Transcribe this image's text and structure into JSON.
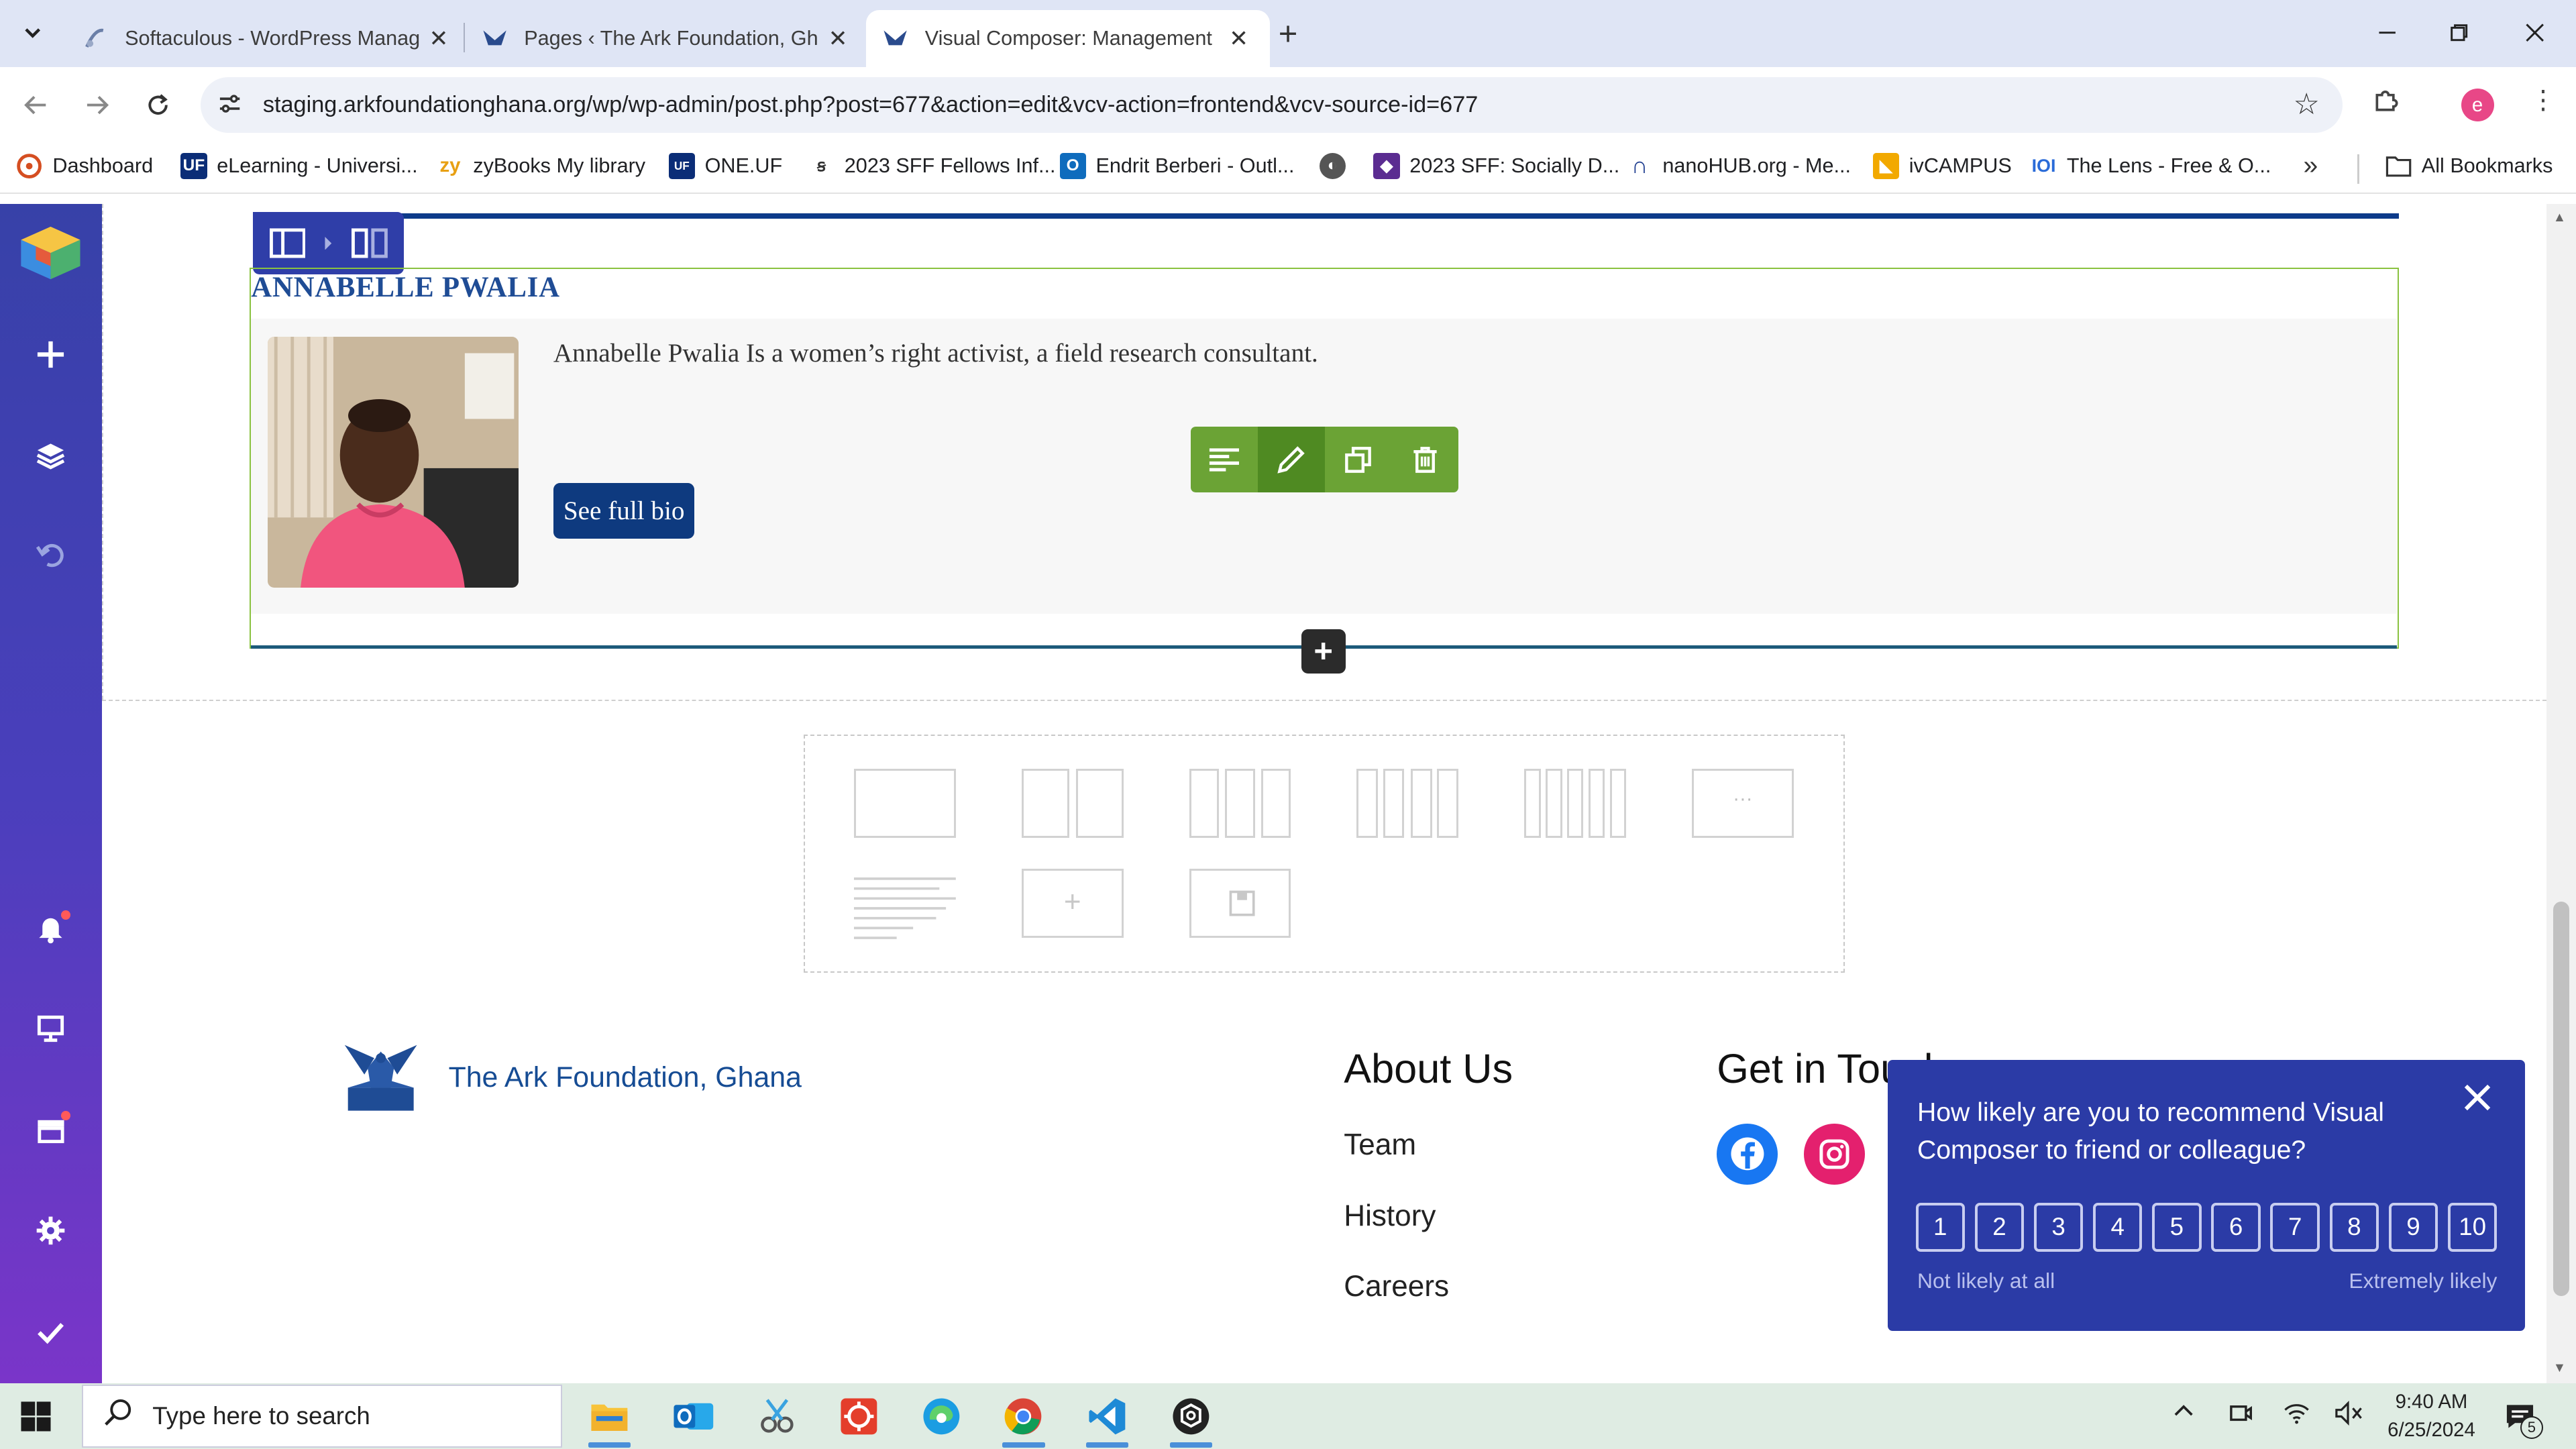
{
  "browser": {
    "tabs": [
      {
        "title": "Softaculous - WordPress Manag",
        "icon": "softaculous-icon",
        "active": false
      },
      {
        "title": "Pages ‹ The Ark Foundation, Gh",
        "icon": "ark-eagle-icon",
        "active": false
      },
      {
        "title": "Visual Composer: Management",
        "icon": "ark-eagle-icon",
        "active": true
      }
    ],
    "url": "staging.arkfoundationghana.org/wp/wp-admin/post.php?post=677&action=edit&vcv-action=frontend&vcv-source-id=677",
    "profile_initial": "e",
    "bookmarks": [
      {
        "label": "Dashboard",
        "icon": "wordpress-icon",
        "color": "#d54e21"
      },
      {
        "label": "eLearning - Universi...",
        "icon": "uf-icon",
        "color": "#0b2d77"
      },
      {
        "label": "zyBooks My library",
        "icon": "zybooks-icon",
        "color": "#e8a013"
      },
      {
        "label": "ONE.UF",
        "icon": "oneuf-icon",
        "color": "#0b2d77"
      },
      {
        "label": "2023 SFF Fellows Inf...",
        "icon": "docs-icon",
        "color": "#333333"
      },
      {
        "label": "Endrit Berberi - Outl...",
        "icon": "outlook-icon",
        "color": "#0f6cbd"
      },
      {
        "label": "",
        "icon": "globe-icon",
        "color": "#555555"
      },
      {
        "label": "2023 SFF: Socially D...",
        "icon": "cube-icon",
        "color": "#5b2c91"
      },
      {
        "label": "nanoHUB.org - Me...",
        "icon": "nanohub-icon",
        "color": "#1d3c8f"
      },
      {
        "label": "ivCAMPUS",
        "icon": "ivcampus-icon",
        "color": "#f2a900"
      },
      {
        "label": "The Lens - Free & O...",
        "icon": "lens-icon",
        "color": "#2a6bd8"
      }
    ],
    "all_bookmarks": "All Bookmarks"
  },
  "editor": {
    "member_name": "ANNABELLE PWALIA",
    "bio": "Annabelle Pwalia Is a women’s right activist, a field research consultant.",
    "bio_button": "See full bio"
  },
  "footer": {
    "org_name": "The Ark Foundation, Ghana",
    "about_heading": "About Us",
    "about_links": [
      "Team",
      "History",
      "Careers"
    ],
    "touch_heading": "Get in Touch"
  },
  "survey": {
    "question": "How likely are you to recommend Visual Composer to friend or colleague?",
    "scale": [
      "1",
      "2",
      "3",
      "4",
      "5",
      "6",
      "7",
      "8",
      "9",
      "10"
    ],
    "low_label": "Not likely at all",
    "high_label": "Extremely likely"
  },
  "taskbar": {
    "search_placeholder": "Type here to search",
    "time": "9:40 AM",
    "date": "6/25/2024",
    "notification_count": "5"
  },
  "colors": {
    "vc_sidebar": "#3741a8",
    "vc_green": "#6ba335",
    "ark_blue": "#164c94",
    "survey_bg": "#2b3ba6"
  }
}
